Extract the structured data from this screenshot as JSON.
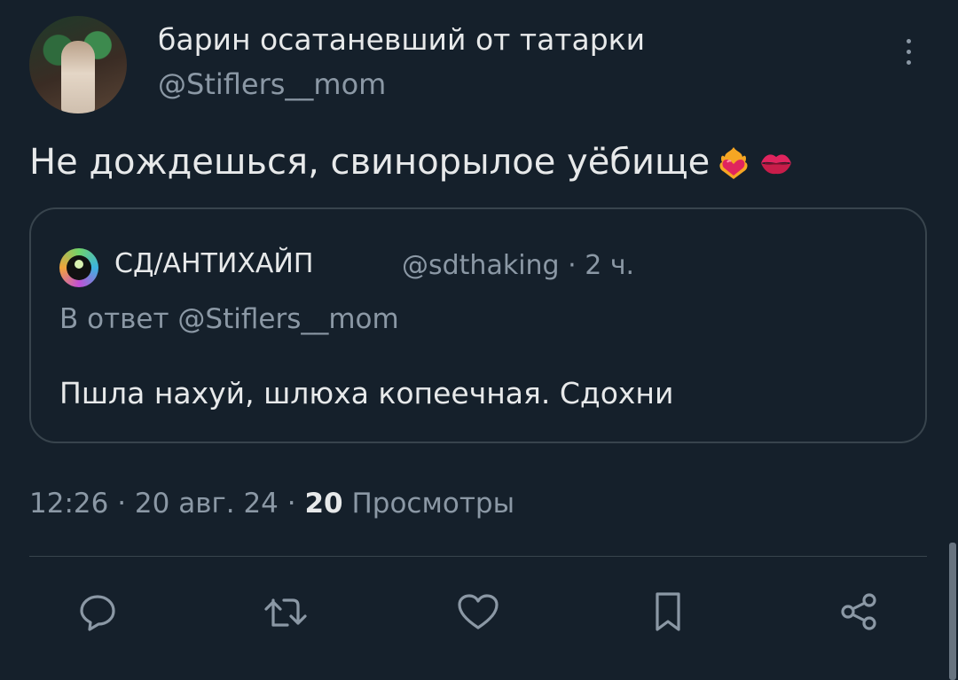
{
  "author": {
    "display_name": "барин осатаневший от татарки",
    "handle": "@Stiflers__mom"
  },
  "tweet": {
    "text": "Не дождешься, свинорылое уёбище",
    "emojis": [
      "heart-on-fire-icon",
      "kiss-mark-icon"
    ]
  },
  "quoted_tweet": {
    "author_name": "СД/АНТИХАЙП",
    "author_handle_time": "@sdthaking · 2 ч.",
    "reply_to": "В ответ @Stiflers__mom",
    "text": "Пшла нахуй, шлюха копеечная. Сдохни"
  },
  "meta": {
    "time_date": "12:26 · 20 авг. 24 · ",
    "views_count": "20",
    "views_label": " Просмотры"
  },
  "actions": [
    "reply-icon",
    "retweet-icon",
    "like-icon",
    "bookmark-icon",
    "share-icon"
  ],
  "colors": {
    "background": "#15202b",
    "text_primary": "#e7e9ea",
    "text_secondary": "#8b98a5",
    "border": "#38444d"
  }
}
